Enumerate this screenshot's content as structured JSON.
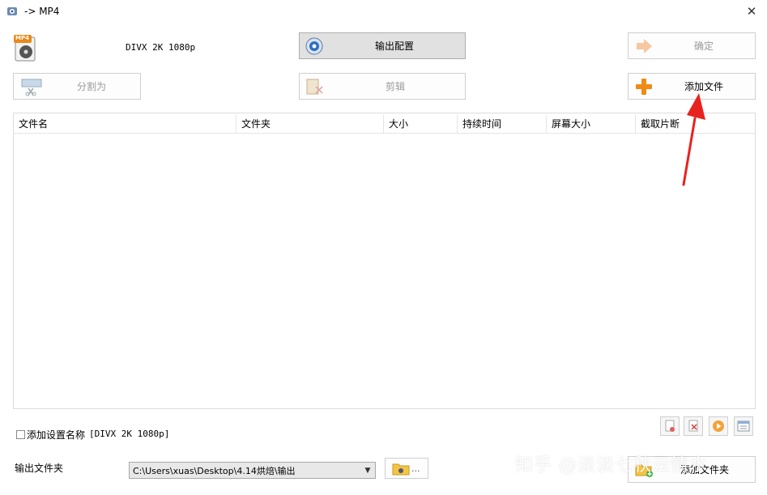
{
  "window": {
    "title": "-> MP4",
    "close": "✕"
  },
  "header": {
    "format_badge": "MP4",
    "profile": "DIVX 2K 1080p"
  },
  "buttons": {
    "output_config": "输出配置",
    "ok": "确定",
    "split": "分割为",
    "edit": "剪辑",
    "add_file": "添加文件",
    "add_folder": "添加文件夹"
  },
  "table": {
    "columns": [
      "文件名",
      "文件夹",
      "大小",
      "持续时间",
      "屏幕大小",
      "截取片断"
    ],
    "rows": []
  },
  "options": {
    "add_setting_name_label": "添加设置名称",
    "add_setting_name_value": "[DIVX 2K 1080p]",
    "checked": false
  },
  "output": {
    "label": "输出文件夹",
    "path": "C:\\Users\\xuas\\Desktop\\4.14烘焙\\输出",
    "browse_suffix": "..."
  },
  "watermark": "知乎 @淡淡七秋云情水",
  "colors": {
    "annotation_arrow": "#e8231f",
    "plus_orange": "#f08a16"
  }
}
